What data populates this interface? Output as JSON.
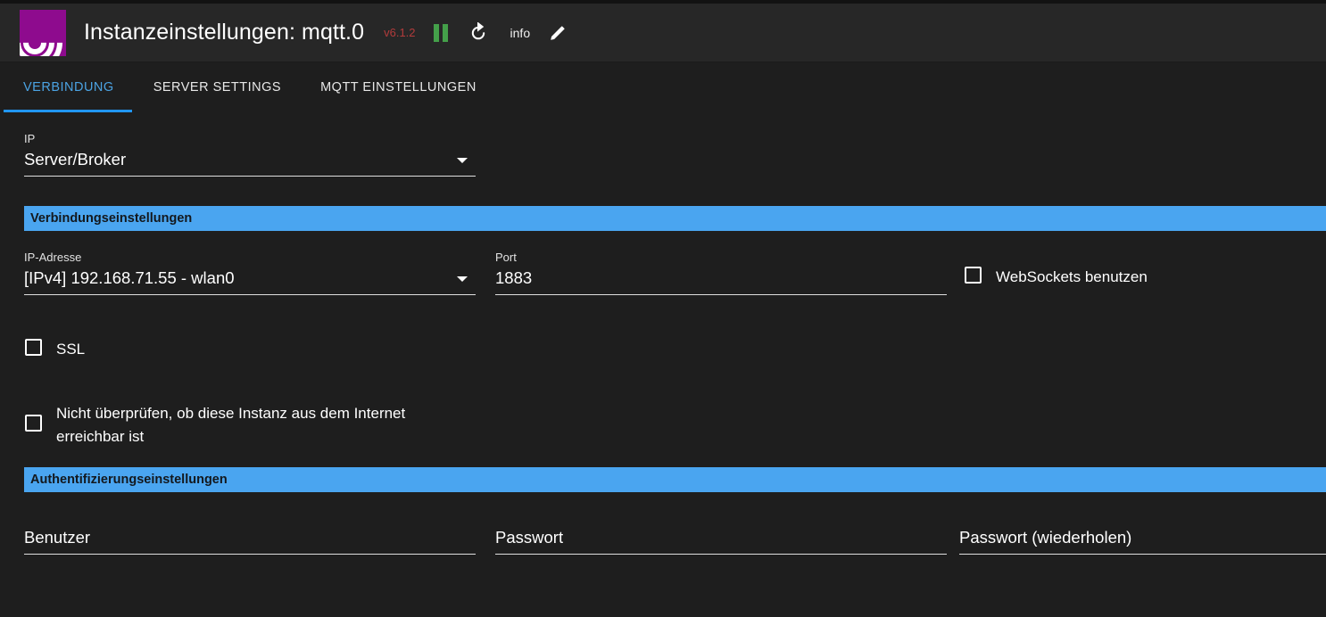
{
  "header": {
    "logo_icon": "mqtt-signal-logo",
    "title": "Instanzeinstellungen: mqtt.0",
    "version": "v6.1.2",
    "pause_icon": "pause-icon",
    "refresh_icon": "refresh-icon",
    "info_label": "info",
    "edit_icon": "pencil-edit-icon",
    "accent_color": "#4aa5f0",
    "version_color": "#b23b3b",
    "pause_color": "#44a04a",
    "logo_color": "#8e0b8e"
  },
  "tabs": [
    {
      "label": "VERBINDUNG",
      "active": true
    },
    {
      "label": "SERVER SETTINGS",
      "active": false
    },
    {
      "label": "MQTT EINSTELLUNGEN",
      "active": false
    }
  ],
  "form": {
    "ip_mode": {
      "label": "IP",
      "value": "Server/Broker",
      "caret_icon": "chevron-down-icon"
    },
    "section_connection": "Verbindungseinstellungen",
    "ip_address": {
      "label": "IP-Adresse",
      "value": "[IPv4] 192.168.71.55 - wlan0",
      "caret_icon": "chevron-down-icon"
    },
    "port": {
      "label": "Port",
      "value": "1883"
    },
    "websockets": {
      "label": "WebSockets benutzen",
      "checked": false
    },
    "ssl": {
      "label": "SSL",
      "checked": false
    },
    "no_check_internet": {
      "label": "Nicht überprüfen, ob diese Instanz aus dem Internet erreichbar ist",
      "checked": false
    },
    "section_auth": "Authentifizierungseinstellungen",
    "user": {
      "label": "Benutzer",
      "value": ""
    },
    "password": {
      "label": "Passwort",
      "value": ""
    },
    "password_repeat": {
      "label": "Passwort (wiederholen)",
      "value": ""
    }
  }
}
